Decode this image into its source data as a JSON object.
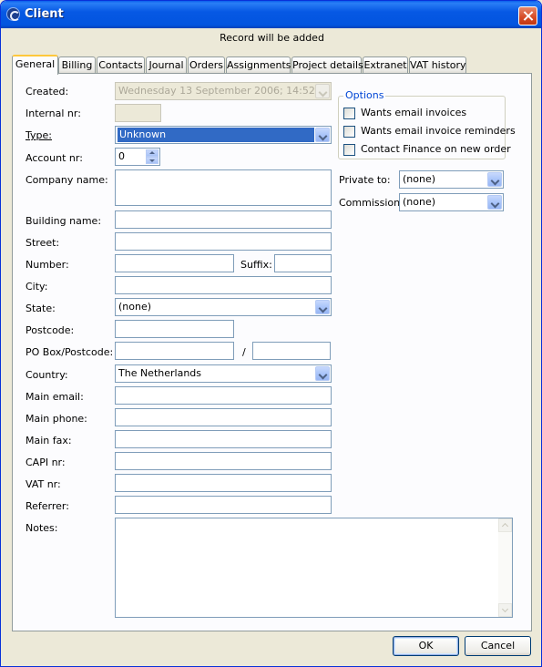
{
  "window": {
    "title": "Client",
    "close_icon": "close-icon"
  },
  "status_message": "Record will be added",
  "tabs": [
    {
      "label": "General",
      "active": true
    },
    {
      "label": "Billing"
    },
    {
      "label": "Contacts"
    },
    {
      "label": "Journal"
    },
    {
      "label": "Orders"
    },
    {
      "label": "Assignments"
    },
    {
      "label": "Project details"
    },
    {
      "label": "Extranet"
    },
    {
      "label": "VAT history"
    }
  ],
  "form": {
    "created": {
      "label": "Created:",
      "value": "Wednesday 13 September 2006; 14:52"
    },
    "internal_nr": {
      "label": "Internal nr:",
      "value": ""
    },
    "type": {
      "label": "Type:",
      "value": "Unknown"
    },
    "account_nr": {
      "label": "Account nr:",
      "value": "0"
    },
    "company_name": {
      "label": "Company name:",
      "value": ""
    },
    "building_name": {
      "label": "Building name:",
      "value": ""
    },
    "street": {
      "label": "Street:",
      "value": ""
    },
    "number": {
      "label": "Number:",
      "value": ""
    },
    "suffix": {
      "label": "Suffix:",
      "value": ""
    },
    "city": {
      "label": "City:",
      "value": ""
    },
    "state": {
      "label": "State:",
      "value": "(none)"
    },
    "postcode": {
      "label": "Postcode:",
      "value": ""
    },
    "po_box": {
      "label": "PO Box/Postcode:",
      "value": "",
      "separator": "/",
      "value2": ""
    },
    "country": {
      "label": "Country:",
      "value": "The Netherlands"
    },
    "main_email": {
      "label": "Main email:",
      "value": ""
    },
    "main_phone": {
      "label": "Main phone:",
      "value": ""
    },
    "main_fax": {
      "label": "Main fax:",
      "value": ""
    },
    "capi_nr": {
      "label": "CAPI nr:",
      "value": ""
    },
    "vat_nr": {
      "label": "VAT nr:",
      "value": ""
    },
    "referrer": {
      "label": "Referrer:",
      "value": ""
    },
    "notes": {
      "label": "Notes:",
      "value": ""
    }
  },
  "options": {
    "legend": "Options",
    "items": [
      {
        "label": "Wants email invoices",
        "checked": false
      },
      {
        "label": "Wants email invoice reminders",
        "checked": false
      },
      {
        "label": "Contact Finance on new order",
        "checked": false
      }
    ]
  },
  "private_to": {
    "label": "Private to:",
    "value": "(none)"
  },
  "commission": {
    "label": "Commission:",
    "value": "(none)"
  },
  "buttons": {
    "ok": "OK",
    "cancel": "Cancel"
  },
  "colors": {
    "titlebar": "#0558e2",
    "selection": "#316ac5",
    "tab_highlight": "#ffc83c",
    "options_legend": "#0046d5"
  }
}
